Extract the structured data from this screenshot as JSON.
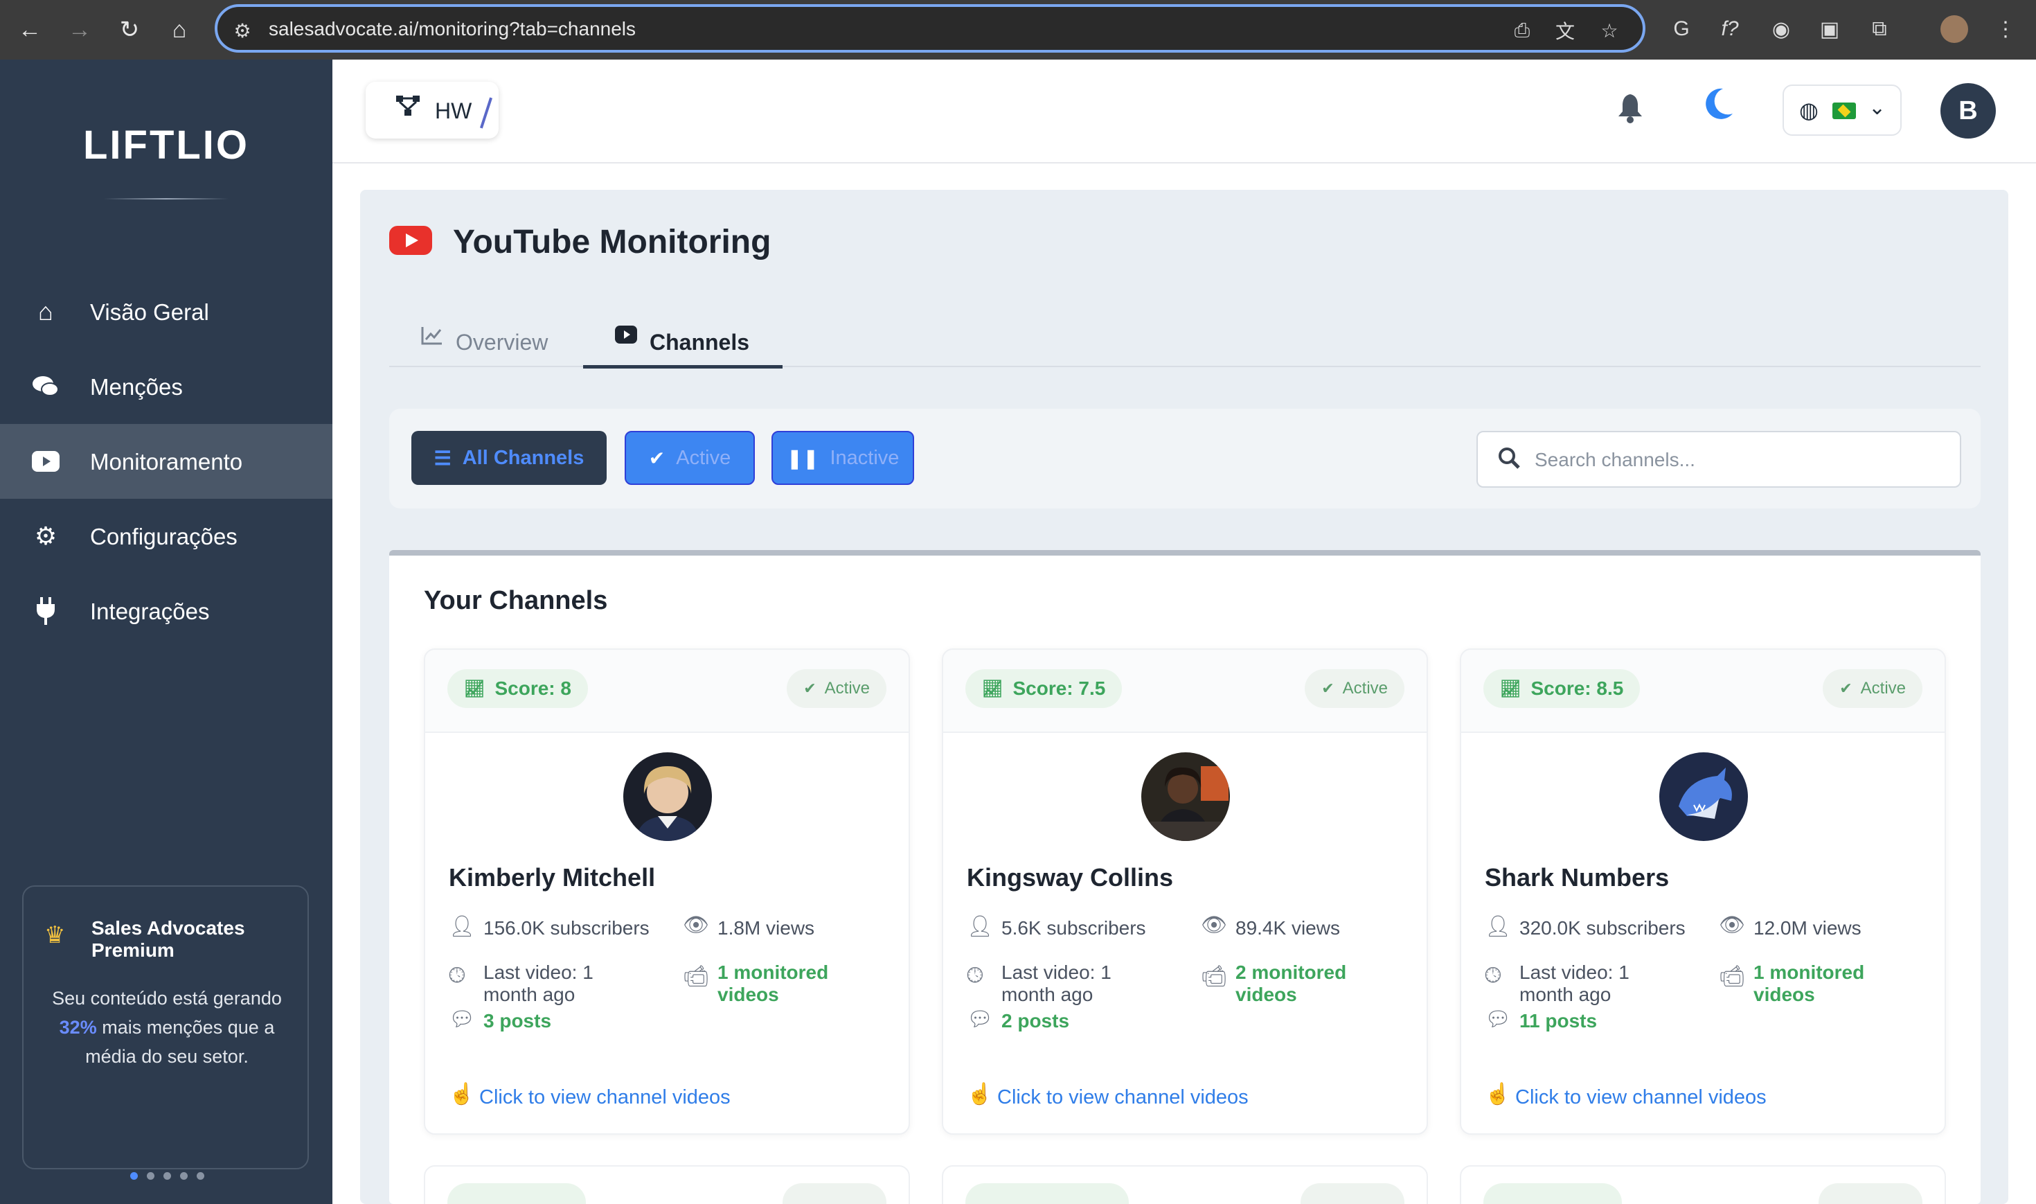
{
  "browser": {
    "url": "salesadvocate.ai/monitoring?tab=channels"
  },
  "sidebar": {
    "logo": "LIFTLIO",
    "items": [
      {
        "label": "Visão Geral",
        "icon": "home-icon"
      },
      {
        "label": "Menções",
        "icon": "comments-icon"
      },
      {
        "label": "Monitoramento",
        "icon": "youtube-icon",
        "active": true
      },
      {
        "label": "Configurações",
        "icon": "gear-icon"
      },
      {
        "label": "Integrações",
        "icon": "plug-icon"
      }
    ],
    "premium": {
      "title": "Sales Advocates Premium",
      "text_before": "Seu conteúdo está gerando ",
      "highlight": "32%",
      "text_after": " mais menções que a média do seu setor."
    }
  },
  "topbar": {
    "project": "HW",
    "avatar_letter": "B"
  },
  "page": {
    "title": "YouTube Monitoring",
    "tabs": [
      {
        "label": "Overview"
      },
      {
        "label": "Channels",
        "active": true
      }
    ],
    "filters": {
      "all": "All Channels",
      "active": "Active",
      "inactive": "Inactive"
    },
    "search": {
      "placeholder": "Search channels...",
      "value": ""
    },
    "channels_title": "Your Channels",
    "channels": [
      {
        "score": "Score: 8",
        "status": "Active",
        "name": "Kimberly Mitchell",
        "subscribers": "156.0K subscribers",
        "views": "1.8M views",
        "last_video": "Last video: 1 month ago",
        "monitored": "1 monitored videos",
        "posts": "3 posts",
        "link": "Click to view channel videos"
      },
      {
        "score": "Score: 7.5",
        "status": "Active",
        "name": "Kingsway Collins",
        "subscribers": "5.6K subscribers",
        "views": "89.4K views",
        "last_video": "Last video: 1 month ago",
        "monitored": "2 monitored videos",
        "posts": "2 posts",
        "link": "Click to view channel videos"
      },
      {
        "score": "Score: 8.5",
        "status": "Active",
        "name": "Shark Numbers",
        "subscribers": "320.0K subscribers",
        "views": "12.0M views",
        "last_video": "Last video: 1 month ago",
        "monitored": "1 monitored videos",
        "posts": "11 posts",
        "link": "Click to view channel videos"
      }
    ]
  },
  "colors": {
    "sidebar_bg": "#2d3b4e",
    "accent_blue": "#3d86f2",
    "score_green": "#3da55c",
    "youtube_red": "#e8312b"
  }
}
